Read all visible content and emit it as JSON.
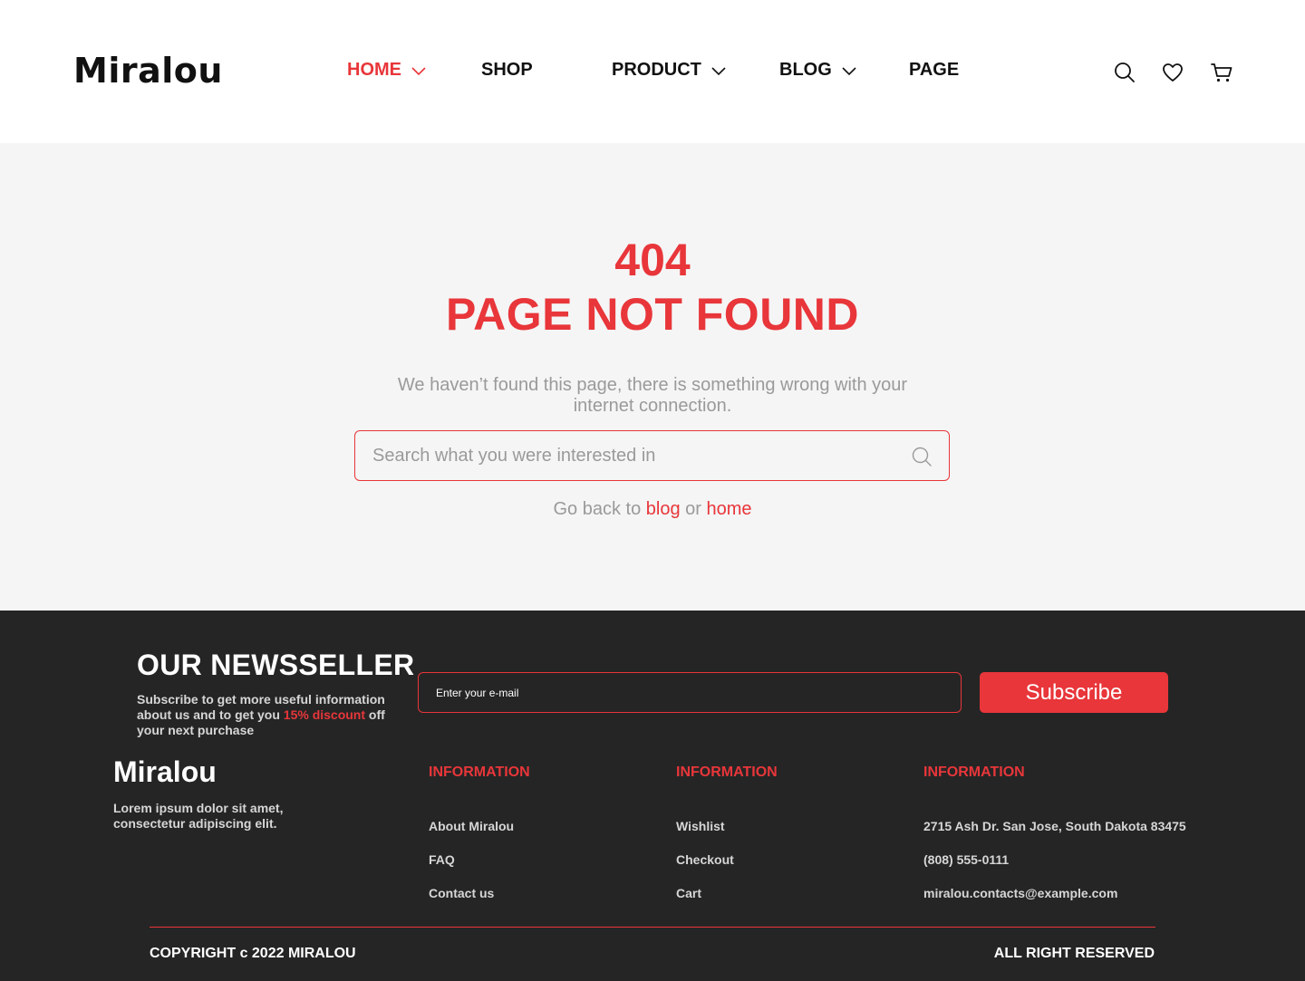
{
  "header": {
    "logo": "Miralou",
    "nav": [
      {
        "label": "HOME",
        "has_dropdown": true,
        "active": true
      },
      {
        "label": "SHOP",
        "has_dropdown": false,
        "active": false
      },
      {
        "label": "PRODUCT",
        "has_dropdown": true,
        "active": false
      },
      {
        "label": "BLOG",
        "has_dropdown": true,
        "active": false
      },
      {
        "label": "PAGE",
        "has_dropdown": false,
        "active": false
      }
    ],
    "icons": [
      "search-icon",
      "heart-icon",
      "cart-icon"
    ]
  },
  "error": {
    "code": "404",
    "title": "PAGE NOT FOUND",
    "description": "We haven’t found this page, there is something wrong with your internet connection.",
    "search_placeholder": "Search what you were interested in",
    "goback_prefix": "Go back to",
    "goback_link1": "blog",
    "goback_middle": "or",
    "goback_link2": "home"
  },
  "footer": {
    "newsletter_title": "OUR NEWSSELLER",
    "newsletter_text_1": "Subscribe to get more useful information about us and to get you",
    "newsletter_highlight": "15% discount",
    "newsletter_text_2": "off your next purchase",
    "email_placeholder": "Enter your e-mail",
    "subscribe_label": "Subscribe",
    "logo": "Miralou",
    "about": "Lorem ipsum dolor sit amet, consectetur adipiscing elit.",
    "columns": [
      {
        "title": "INFORMATION",
        "items": [
          "About Miralou",
          "FAQ",
          "Contact us"
        ]
      },
      {
        "title": "INFORMATION",
        "items": [
          "Wishlist",
          "Checkout",
          "Cart"
        ]
      },
      {
        "title": "INFORMATION",
        "items": [
          "2715 Ash Dr. San Jose, South Dakota 83475",
          "(808) 555-0111",
          "miralou.contacts@example.com"
        ]
      }
    ],
    "copyright": "COPYRIGHT c 2022 MIRALOU",
    "rights": "ALL RIGHT RESERVED"
  },
  "colors": {
    "accent": "#e8363a",
    "footer_bg": "#252525",
    "main_bg": "#f5f5f5"
  }
}
